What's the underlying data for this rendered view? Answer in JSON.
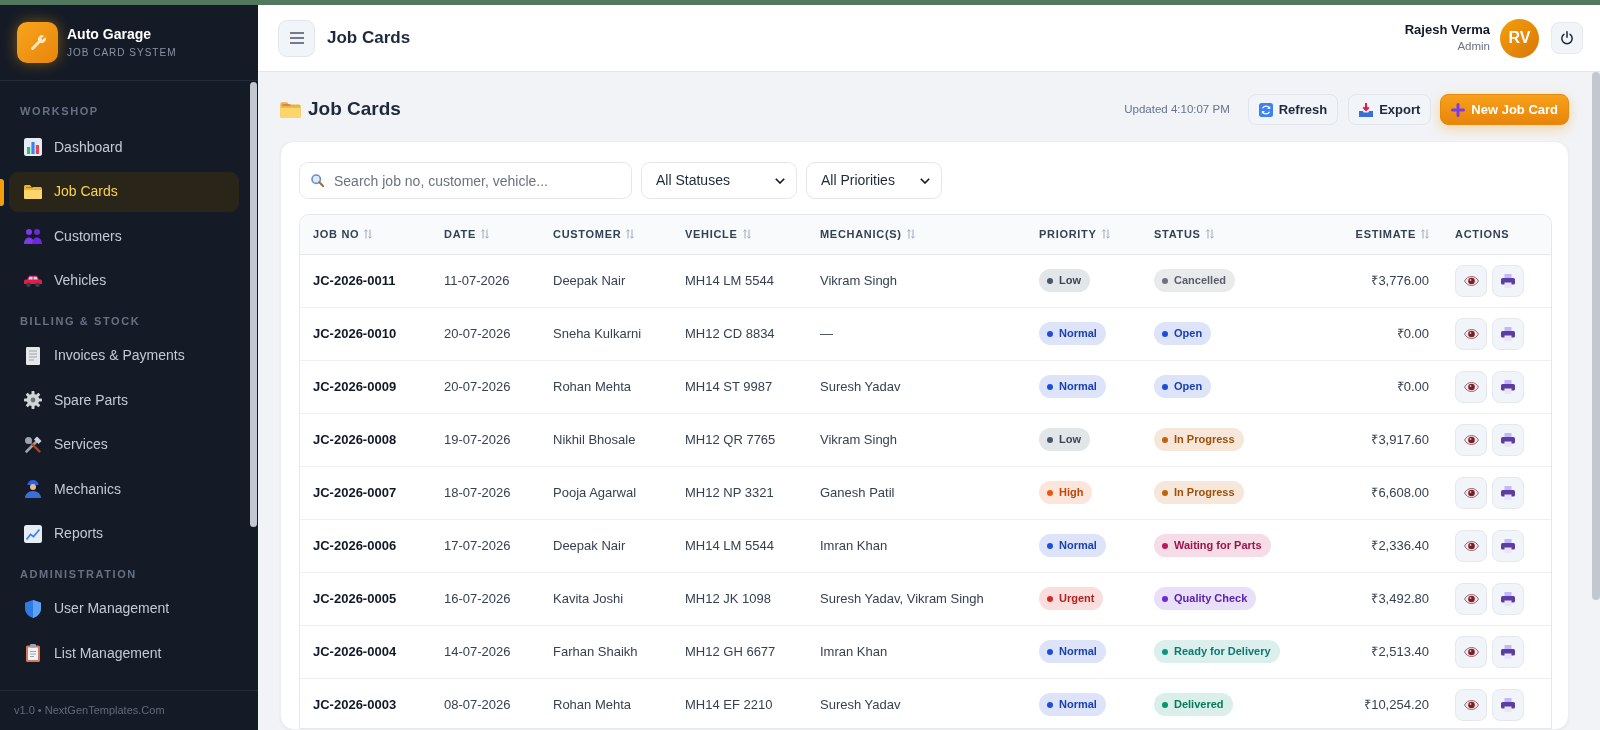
{
  "sidebar": {
    "brand": {
      "title": "Auto Garage",
      "subtitle": "JOB CARD SYSTEM"
    },
    "sections": [
      {
        "title": "WORKSHOP",
        "items": [
          {
            "label": "Dashboard",
            "selected": false
          },
          {
            "label": "Job Cards",
            "selected": true
          },
          {
            "label": "Customers",
            "selected": false
          },
          {
            "label": "Vehicles",
            "selected": false
          }
        ]
      },
      {
        "title": "BILLING & STOCK",
        "items": [
          {
            "label": "Invoices & Payments",
            "selected": false
          },
          {
            "label": "Spare Parts",
            "selected": false
          },
          {
            "label": "Services",
            "selected": false
          },
          {
            "label": "Mechanics",
            "selected": false
          },
          {
            "label": "Reports",
            "selected": false
          }
        ]
      },
      {
        "title": "ADMINISTRATION",
        "items": [
          {
            "label": "User Management",
            "selected": false
          },
          {
            "label": "List Management",
            "selected": false
          }
        ]
      }
    ],
    "footer": "v1.0 • NextGenTemplates.Com"
  },
  "header": {
    "title": "Job Cards",
    "user": {
      "name": "Rajesh Verma",
      "role": "Admin",
      "initials": "RV"
    }
  },
  "page": {
    "title": "Job Cards",
    "updated": "Updated 4:10:07 PM",
    "buttons": [
      {
        "label": "Refresh",
        "kind": "secondary"
      },
      {
        "label": "Export",
        "kind": "secondary"
      },
      {
        "label": "New Job Card",
        "kind": "primary"
      }
    ]
  },
  "filters": {
    "search": {
      "placeholder": "Search job no, customer, vehicle..."
    },
    "selects": [
      {
        "value": "All Statuses"
      },
      {
        "value": "All Priorities"
      }
    ]
  },
  "table": {
    "columns": [
      {
        "label": "JOB NO",
        "sortable": true
      },
      {
        "label": "DATE",
        "sortable": true
      },
      {
        "label": "CUSTOMER",
        "sortable": true
      },
      {
        "label": "VEHICLE",
        "sortable": true
      },
      {
        "label": "MECHANIC(S)",
        "sortable": true
      },
      {
        "label": "PRIORITY",
        "sortable": true
      },
      {
        "label": "STATUS",
        "sortable": true
      },
      {
        "label": "ESTIMATE",
        "sortable": true
      },
      {
        "label": "ACTIONS",
        "sortable": false
      }
    ],
    "rows": [
      {
        "job_no": "JC-2026-0011",
        "date": "11-07-2026",
        "customer": "Deepak Nair",
        "vehicle": "MH14 LM 5544",
        "mechanics": "Vikram Singh",
        "priority": {
          "text": "Low",
          "color": "#475569"
        },
        "status": {
          "text": "Cancelled",
          "color": "#6b7280"
        },
        "estimate": "₹3,776.00"
      },
      {
        "job_no": "JC-2026-0010",
        "date": "20-07-2026",
        "customer": "Sneha Kulkarni",
        "vehicle": "MH12 CD 8834",
        "mechanics": "—",
        "priority": {
          "text": "Normal",
          "color": "#1d4ed8"
        },
        "status": {
          "text": "Open",
          "color": "#1d4ed8"
        },
        "estimate": "₹0.00"
      },
      {
        "job_no": "JC-2026-0009",
        "date": "20-07-2026",
        "customer": "Rohan Mehta",
        "vehicle": "MH14 ST 9987",
        "mechanics": "Suresh Yadav",
        "priority": {
          "text": "Normal",
          "color": "#1d4ed8"
        },
        "status": {
          "text": "Open",
          "color": "#1d4ed8"
        },
        "estimate": "₹0.00"
      },
      {
        "job_no": "JC-2026-0008",
        "date": "19-07-2026",
        "customer": "Nikhil Bhosale",
        "vehicle": "MH12 QR 7765",
        "mechanics": "Vikram Singh",
        "priority": {
          "text": "Low",
          "color": "#475569"
        },
        "status": {
          "text": "In Progress",
          "color": "#c2620a"
        },
        "estimate": "₹3,917.60"
      },
      {
        "job_no": "JC-2026-0007",
        "date": "18-07-2026",
        "customer": "Pooja Agarwal",
        "vehicle": "MH12 NP 3321",
        "mechanics": "Ganesh Patil",
        "priority": {
          "text": "High",
          "color": "#ea580c"
        },
        "status": {
          "text": "In Progress",
          "color": "#c2620a"
        },
        "estimate": "₹6,608.00"
      },
      {
        "job_no": "JC-2026-0006",
        "date": "17-07-2026",
        "customer": "Deepak Nair",
        "vehicle": "MH14 LM 5544",
        "mechanics": "Imran Khan",
        "priority": {
          "text": "Normal",
          "color": "#1d4ed8"
        },
        "status": {
          "text": "Waiting for Parts",
          "color": "#be185d"
        },
        "estimate": "₹2,336.40"
      },
      {
        "job_no": "JC-2026-0005",
        "date": "16-07-2026",
        "customer": "Kavita Joshi",
        "vehicle": "MH12 JK 1098",
        "mechanics": "Suresh Yadav, Vikram Singh",
        "priority": {
          "text": "Urgent",
          "color": "#dc2626"
        },
        "status": {
          "text": "Quality Check",
          "color": "#6d28d9"
        },
        "estimate": "₹3,492.80"
      },
      {
        "job_no": "JC-2026-0004",
        "date": "14-07-2026",
        "customer": "Farhan Shaikh",
        "vehicle": "MH12 GH 6677",
        "mechanics": "Imran Khan",
        "priority": {
          "text": "Normal",
          "color": "#1d4ed8"
        },
        "status": {
          "text": "Ready for Delivery",
          "color": "#0d9488"
        },
        "estimate": "₹2,513.40"
      },
      {
        "job_no": "JC-2026-0003",
        "date": "08-07-2026",
        "customer": "Rohan Mehta",
        "vehicle": "MH14 EF 2210",
        "mechanics": "Suresh Yadav",
        "priority": {
          "text": "Normal",
          "color": "#1d4ed8"
        },
        "status": {
          "text": "Delivered",
          "color": "#059669"
        },
        "estimate": "₹10,254.20"
      }
    ]
  }
}
